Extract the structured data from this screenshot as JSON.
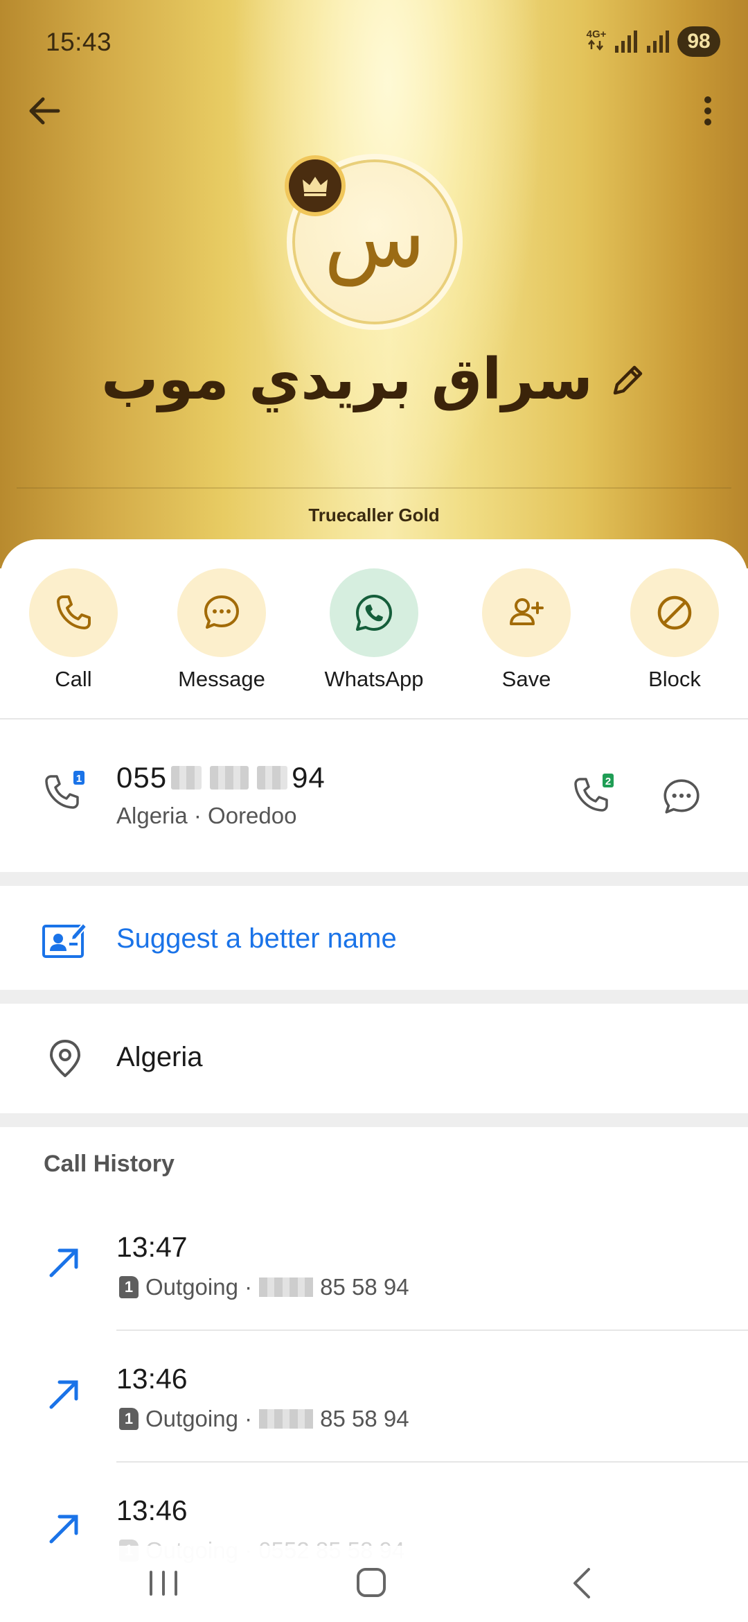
{
  "status": {
    "time": "15:43",
    "network_label": "4G+",
    "battery": "98"
  },
  "profile": {
    "avatar_letter": "س",
    "name": "سراق بريدي موب",
    "tier_label": "Truecaller Gold"
  },
  "actions": [
    {
      "label": "Call",
      "icon": "phone-icon"
    },
    {
      "label": "Message",
      "icon": "chat-icon"
    },
    {
      "label": "WhatsApp",
      "icon": "whatsapp-icon"
    },
    {
      "label": "Save",
      "icon": "add-person-icon"
    },
    {
      "label": "Block",
      "icon": "block-icon"
    }
  ],
  "number": {
    "prefix": "055",
    "suffix": "94",
    "details": "Algeria · Ooredoo",
    "sim1_badge": "1",
    "sim2_badge": "2"
  },
  "suggest_label": "Suggest a better name",
  "location": "Algeria",
  "call_history": {
    "title": "Call History",
    "items": [
      {
        "time": "13:47",
        "type": "Outgoing ·",
        "number_tail": "85 58 94",
        "sim": "1"
      },
      {
        "time": "13:46",
        "type": "Outgoing ·",
        "number_tail": "85 58 94",
        "sim": "1"
      },
      {
        "time": "13:46",
        "type": "Outgoing · 0552 85 58 94",
        "number_tail": "",
        "sim": "1"
      }
    ]
  },
  "colors": {
    "accent_blue": "#1a73e8",
    "gold_dark": "#3b240a",
    "action_bg": "#fcefcc",
    "whatsapp_bg": "#d6eedf"
  }
}
